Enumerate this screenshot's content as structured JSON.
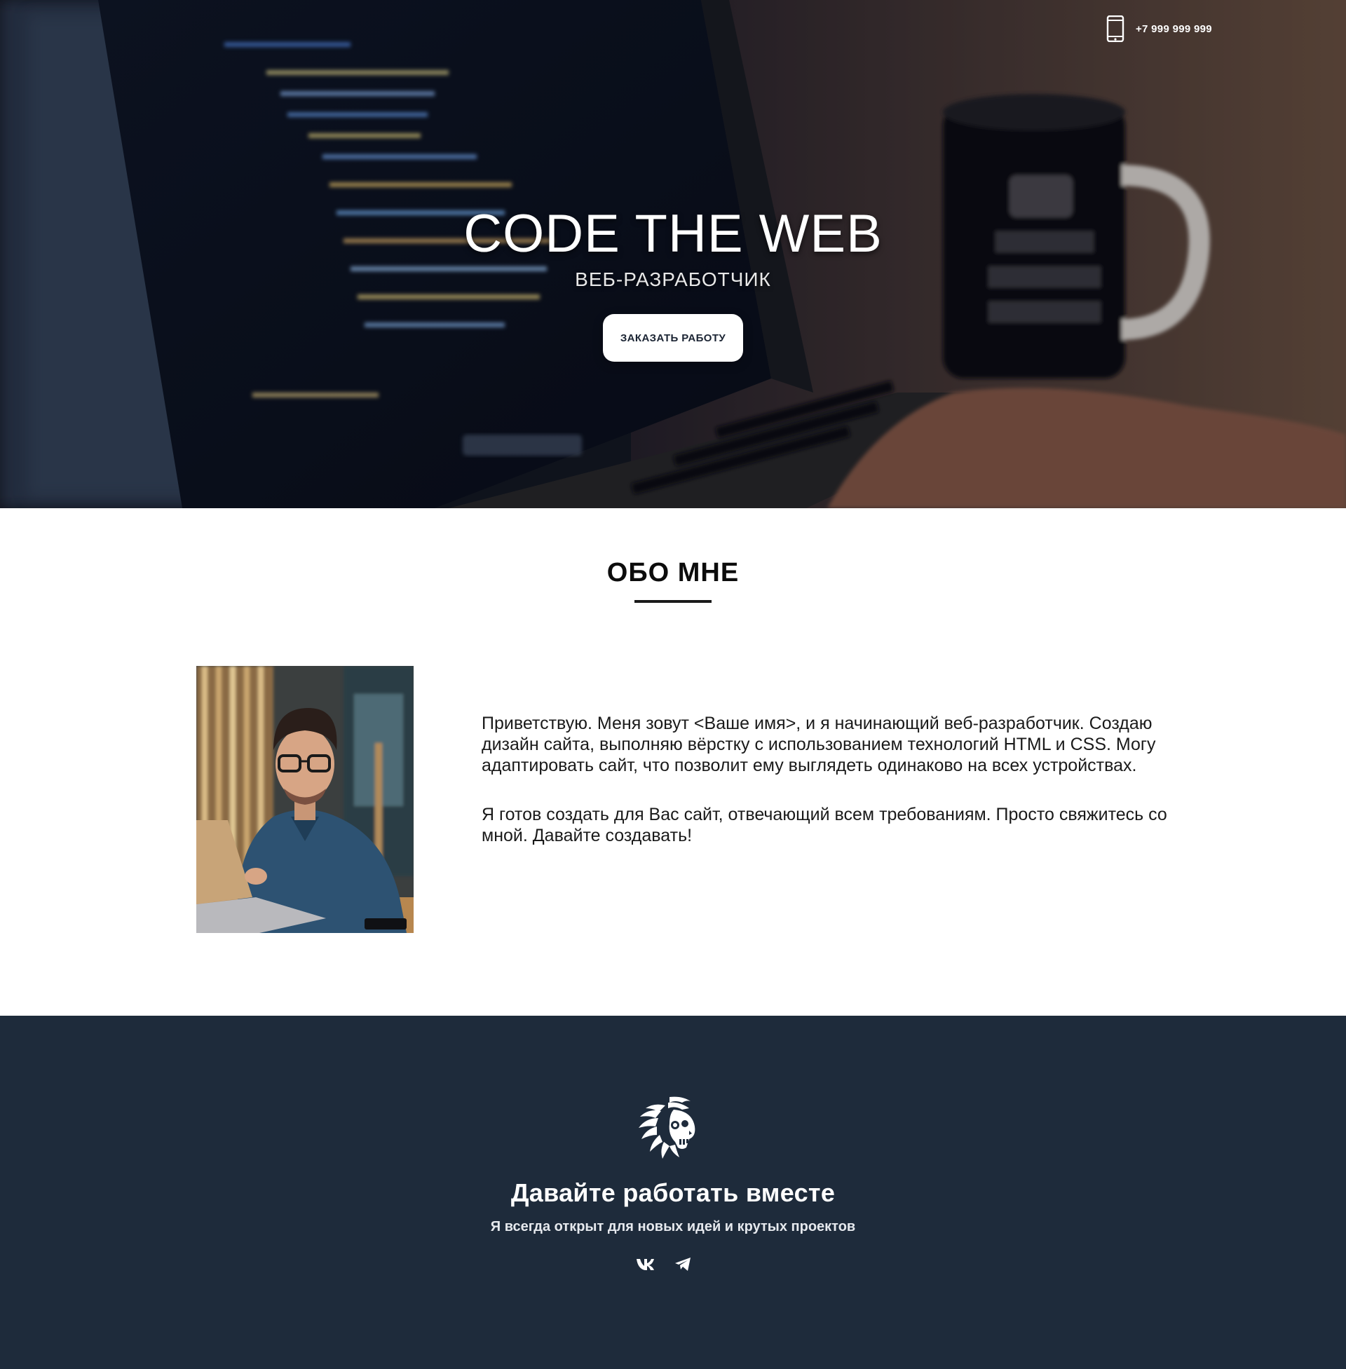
{
  "header": {
    "phone": "+7 999 999 999"
  },
  "hero": {
    "title": "CODE THE WEB",
    "subtitle": "ВЕБ-РАЗРАБОТЧИК",
    "button_label": "ЗАКАЗАТЬ РАБОТУ"
  },
  "about": {
    "heading": "ОБО МНЕ",
    "paragraph_1": "Приветствую. Меня зовут <Ваше имя>, и я начинающий веб-разработчик. Создаю дизайн сайта, выполняю вёрстку с использованием технологий HTML и CSS. Могу адаптировать сайт, что позволит ему выглядеть одинаково на всех устройствах.",
    "paragraph_2": "Я готов создать для Вас сайт, отвечающий всем требованиям. Просто свяжитесь со мной. Давайте создавать!"
  },
  "footer": {
    "title": "Давайте работать вместе",
    "subtitle": "Я всегда открыт для новых идей и крутых проектов",
    "socials": [
      {
        "icon": "vk-icon"
      },
      {
        "icon": "telegram-icon"
      }
    ]
  },
  "colors": {
    "footer_bg": "#1e2b3b",
    "button_text": "#1b2433",
    "text_dark": "#1a1a1a"
  }
}
